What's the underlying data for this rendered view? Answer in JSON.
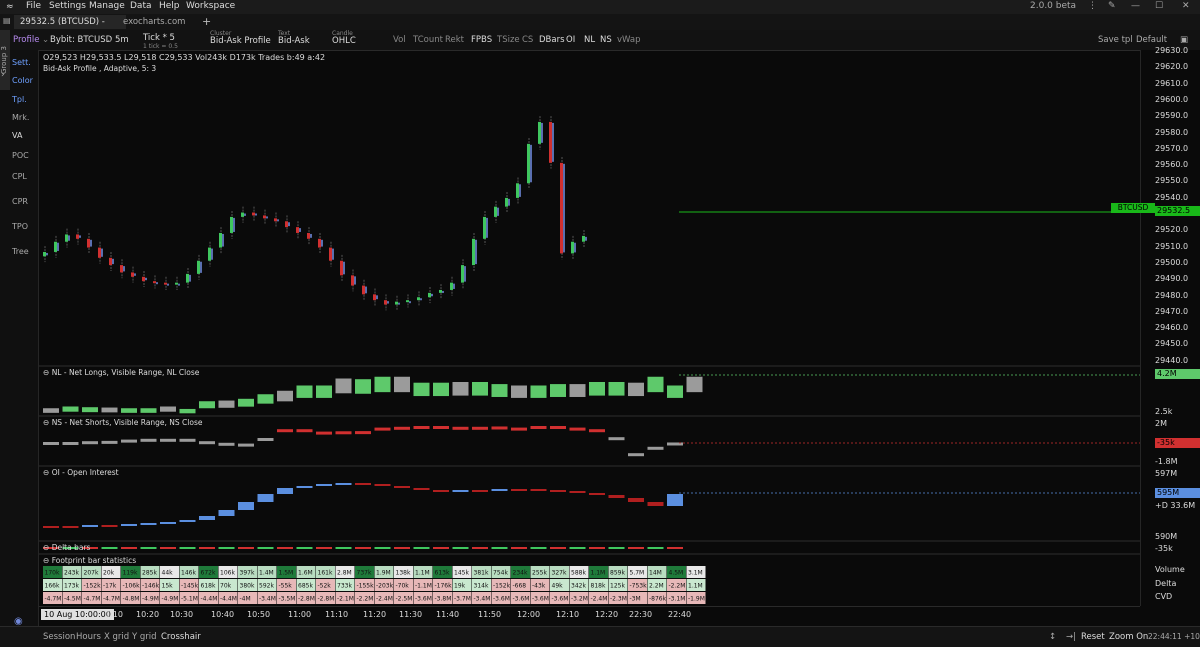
{
  "window": {
    "version": "2.0.0 beta"
  },
  "menu": [
    "File",
    "Settings",
    "Manage",
    "Data",
    "Help",
    "Workspace"
  ],
  "tabs": [
    {
      "label": "29532.5 (BTCUSD) - Ex..."
    },
    {
      "label": "exocharts.com"
    },
    {
      "label": "+"
    }
  ],
  "toolbar": {
    "profile": "Profile",
    "symbol": "Bybit: BTCUSD",
    "timeframe": "5m",
    "tick": "Tick * 5",
    "tick_sub": "1 tick = 0.5",
    "cluster_caption": "Cluster",
    "cluster": "Bid-Ask Profile",
    "text_caption": "Text",
    "text": "Bid-Ask",
    "candle_caption": "Candle",
    "candle": "OHLC",
    "toggles": [
      "Vol",
      "TCount",
      "Rekt",
      "FPBS",
      "TSize",
      "CS",
      "DBars",
      "OI",
      "NL",
      "NS",
      "vWap"
    ],
    "save_tpl": "Save tpl",
    "default": "Default"
  },
  "sidebar": {
    "group": "Group 3",
    "items": [
      "Sett.",
      "Color",
      "Tpl.",
      "Mrk.",
      "VA",
      "POC",
      "CPL",
      "CPR",
      "TPO",
      "Tree"
    ]
  },
  "ohlc": {
    "o": "O29,523",
    "h": "H29,533.5",
    "l": "L29,518",
    "c": "C29,533",
    "vol": "Vol243k",
    "delta": "D173k",
    "trades": "Trades b:49 a:42",
    "subtitle": "Bid-Ask Profile , Adaptive, 5: 3"
  },
  "price_axis": [
    "29630.0",
    "29620.0",
    "29610.0",
    "29600.0",
    "29590.0",
    "29580.0",
    "29570.0",
    "29560.0",
    "29550.0",
    "29540.0",
    "29530.0",
    "29520.0",
    "29510.0",
    "29500.0",
    "29490.0",
    "29480.0",
    "29470.0",
    "29460.0",
    "29450.0",
    "29440.0"
  ],
  "last_price": {
    "symbol": "BTCUSD",
    "value": "29532.5"
  },
  "nl_panel": {
    "title": "NL - Net Longs, Visible Range, NL Close",
    "labels": [
      "35k",
      "126k",
      "97k",
      "94k",
      "55k",
      "63k",
      "121k",
      "28k",
      "433k",
      "448k",
      "544k",
      "793k",
      "1.4M",
      "2.1M",
      "2.1M",
      "4M",
      "3.9M",
      "4.5M",
      "4.5M",
      "3.2M",
      "3.2M",
      "3.3M",
      "3.3M",
      "3M",
      "2.8M",
      "2.8M",
      "3M",
      "3M",
      "3.3M",
      "3.3M",
      "3.2M",
      "4.2M",
      "2.8M",
      "4.2M"
    ],
    "axis_top": "4.2M",
    "axis_bottom": "2.5k"
  },
  "ns_panel": {
    "title": "NS - Net Shorts, Visible Range, NS Close",
    "labels": [
      "-15k",
      "-102k",
      "57k",
      "74k",
      "171k",
      "216k",
      "216k",
      "216k",
      "52k",
      "-55k",
      "-106k",
      "266k",
      "921k",
      "922k",
      "736k",
      "758k",
      "772k",
      "1.1M",
      "1.2M",
      "1.3M",
      "1.8M",
      "1.6M",
      "1.6M",
      "1.7M",
      "1.4M",
      "1.8M",
      "1.8M",
      "1.4M",
      "1.2M",
      "392k",
      "-1M",
      "-396k",
      "-35k"
    ],
    "axis_top": "2M",
    "axis_mid": "-35k",
    "axis_bottom": "-1.8M"
  },
  "oi_panel": {
    "title": "OI - Open Interest",
    "axis_top": "597M",
    "axis_mid": "595M",
    "axis_delta": "+D 33.6M",
    "axis_bottom": "590M"
  },
  "delta_panel": {
    "title": "Delta bars",
    "axis": "-35k"
  },
  "footprint": {
    "title": "Footprint bar statistics",
    "row_labels": [
      "Volume",
      "Delta",
      "CVD"
    ],
    "volume": [
      "170k",
      "243k",
      "207k",
      "20k",
      "119k",
      "285k",
      "44k",
      "146k",
      "672k",
      "106k",
      "397k",
      "1.4M",
      "1.5M",
      "1.6M",
      "161k",
      "2.8M",
      "737k",
      "1.9M",
      "138k",
      "1.1M",
      "613k",
      "145k",
      "381k",
      "754k",
      "234k",
      "255k",
      "327k",
      "588k",
      "1.1M",
      "859k",
      "5.7M",
      "14M",
      "4.5M",
      "3.1M"
    ],
    "delta": [
      "166k",
      "173k",
      "-152k",
      "-17k",
      "-106k",
      "-146k",
      "15k",
      "-145k",
      "618k",
      "70k",
      "380k",
      "592k",
      "-55k",
      "685k",
      "-52k",
      "733k",
      "-155k",
      "-203k",
      "-70k",
      "-1.1M",
      "-176k",
      "19k",
      "314k",
      "-152k",
      "-668",
      "-43k",
      "49k",
      "342k",
      "818k",
      "125k",
      "-753k",
      "2.2M",
      "-2.2M",
      "1.1M"
    ],
    "cvd": [
      "-4.7M",
      "-4.5M",
      "-4.7M",
      "-4.7M",
      "-4.8M",
      "-4.9M",
      "-4.9M",
      "-5.1M",
      "-4.4M",
      "-4.4M",
      "-4M",
      "-3.4M",
      "-3.5M",
      "-2.8M",
      "-2.8M",
      "-2.1M",
      "-2.2M",
      "-2.4M",
      "-2.5M",
      "-3.6M",
      "-3.8M",
      "-3.7M",
      "-3.4M",
      "-3.6M",
      "-3.6M",
      "-3.6M",
      "-3.6M",
      "-3.2M",
      "-2.4M",
      "-2.3M",
      "-3M",
      "-876k",
      "-3.1M",
      "-1.9M"
    ]
  },
  "time_axis": {
    "cursor": "10 Aug 10:00:00",
    "ticks": [
      "0:10",
      "10:20",
      "10:30",
      "10:40",
      "10:50",
      "11:00",
      "11:10",
      "11:20",
      "11:30",
      "11:40",
      "11:50",
      "12:00",
      "12:10",
      "12:20",
      "22:30",
      "22:40"
    ]
  },
  "bottombar": {
    "items": [
      "Session",
      "Hours",
      "X grid",
      "Y grid",
      "Crosshair"
    ],
    "reset": "Reset",
    "zoom": "Zoom On",
    "clock": "22:44:11 +10"
  },
  "colors": {
    "up": "#3fc75f",
    "down": "#d13030",
    "accent": "#5b8fe0",
    "last": "#19b819"
  }
}
